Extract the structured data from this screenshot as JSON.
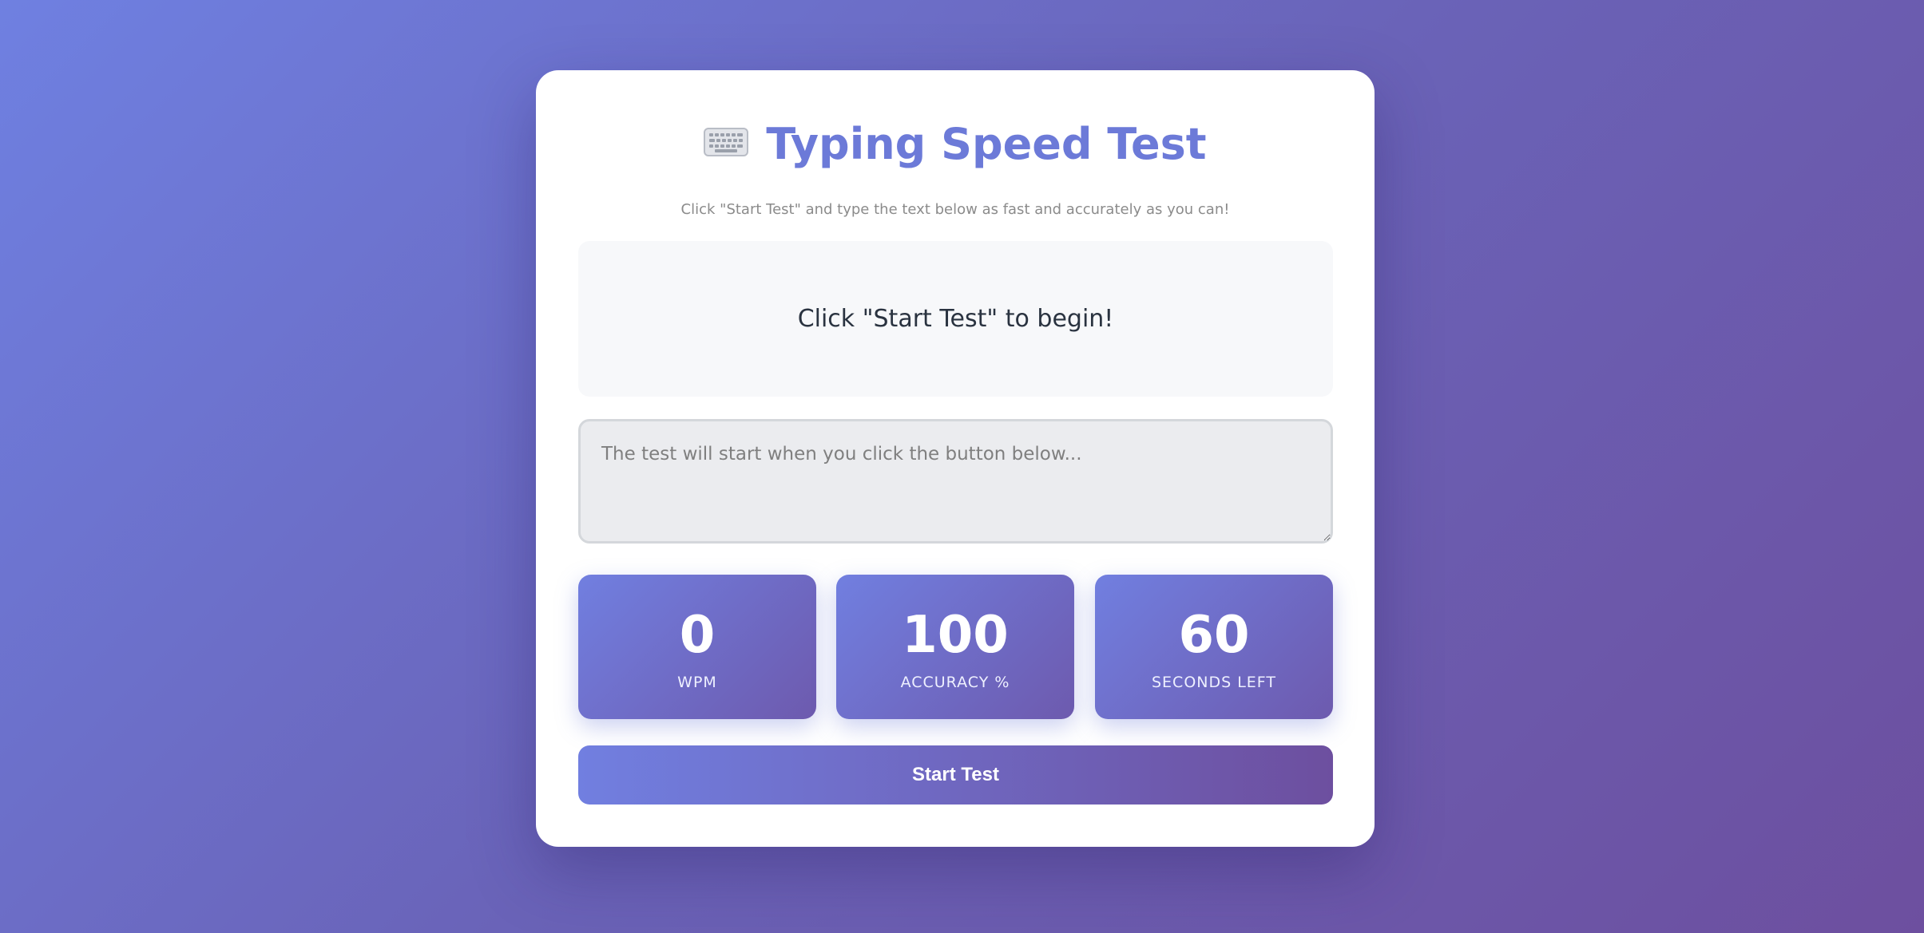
{
  "header": {
    "icon": "keyboard-icon",
    "title": "Typing Speed Test",
    "subtitle": "Click \"Start Test\" and type the text below as fast and accurately as you can!"
  },
  "text_display": {
    "message": "Click \"Start Test\" to begin!"
  },
  "input": {
    "value": "",
    "placeholder": "The test will start when you click the button below..."
  },
  "stats": [
    {
      "value": "0",
      "label": "WPM"
    },
    {
      "value": "100",
      "label": "ACCURACY %"
    },
    {
      "value": "60",
      "label": "SECONDS LEFT"
    }
  ],
  "actions": {
    "start_label": "Start Test"
  },
  "colors": {
    "accent": "#6c7ad8",
    "gradient_start": "#717fe0",
    "gradient_end": "#6d4f9f",
    "background": "#ffffff"
  }
}
